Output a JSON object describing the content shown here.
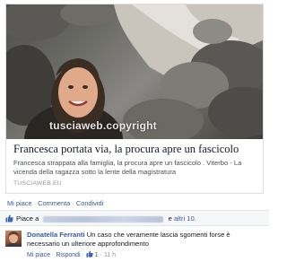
{
  "link_preview": {
    "watermark": "tusciaweb.copyright",
    "headline": "Francesca portata via, la procura apre un fascicolo",
    "description": "Francesca strappata alla famiglia, la procura apre un fascicolo . Viterbo - La vicenda della ragazza sotto la lente della magistratura",
    "source": "TUSCIAWEB.EU"
  },
  "actions": {
    "like": "Mi piace",
    "sep1": "·",
    "comment": "Commenta",
    "sep2": "·",
    "share": "Condividi"
  },
  "likes_summary": {
    "prefix": "Piace a",
    "suffix": "e",
    "others": "altri 10."
  },
  "comment": {
    "author": "Donatella Ferranti",
    "text": "Un caso che veramente lascia sgomenti forse è necessario un ulteriore approfondimento",
    "like": "Mi piace",
    "sep1": "·",
    "reply": "Rispondi",
    "sep2": "·",
    "like_count": "1",
    "sep3": "·",
    "time": "11 h"
  },
  "colors": {
    "link": "#365899",
    "like_icon": "#4267b2"
  }
}
